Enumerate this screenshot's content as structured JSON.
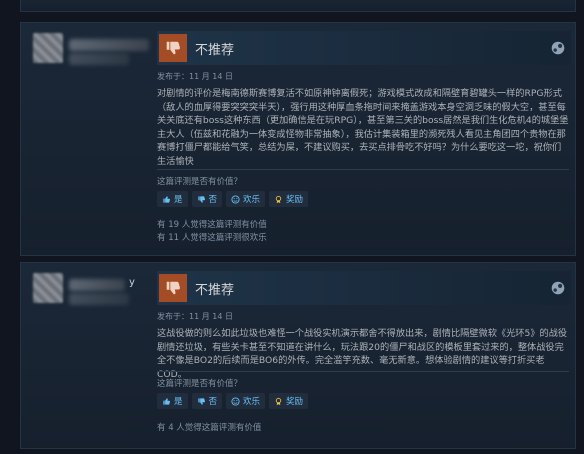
{
  "reviews": [
    {
      "author_suffix": "",
      "verdict": "不推荐",
      "posted": "发布于：11 月 14 日",
      "body": "对剧情的评价是梅南德斯赛博复活不如原神钟离假死；游戏模式改成和隔壁育碧罐头一样的RPG形式（敌人的血厚得要突突突半天），强行用这种厚血条拖时间来掩盖游戏本身空洞乏味的假大空，甚至每关关底还有boss这种东西（更加确信是在玩RPG），甚至第三关的boss居然是我们生化危机4的城堡堡主大人（伍兹和花融为一体变成怪物非常抽象），我估计集装箱里的濒死残人看见主角团四个贵物在那赛博打僵尸都能给气笑，总结为屎，不建议购买，去买点排骨吃不好吗？为什么要吃这一坨，祝你们生活愉快",
      "question": "这篇评测是否有价值？",
      "buttons": {
        "yes": "是",
        "no": "否",
        "funny": "欢乐",
        "award": "奖励"
      },
      "stat1": "有 19 人觉得这篇评测有价值",
      "stat2": "有 11 人觉得这篇评测很欢乐"
    },
    {
      "author_suffix": "y",
      "verdict": "不推荐",
      "posted": "发布于：11 月 14 日",
      "body": "这战役做的则么如此垃圾也难怪一个战役实机演示都舍不得放出来，剧情比隔壁微软《光环5》的战役剧情还垃圾，有些关卡甚至不知道在讲什么，玩法跟20的僵尸和战区的模板里套过来的，整体战役完全不像是BO2的后续而是BO6的外传。完全滥竽充数、毫无新意。想体验剧情的建议等打折买老COD。",
      "question": "这篇评测是否有价值？",
      "buttons": {
        "yes": "是",
        "no": "否",
        "funny": "欢乐",
        "award": "奖励"
      },
      "stat1": "有 4 人觉得这篇评测有价值"
    }
  ],
  "colors": {
    "thumb_bg": "#a34c25",
    "link": "#66c0f4",
    "award": "#e8c33c"
  }
}
